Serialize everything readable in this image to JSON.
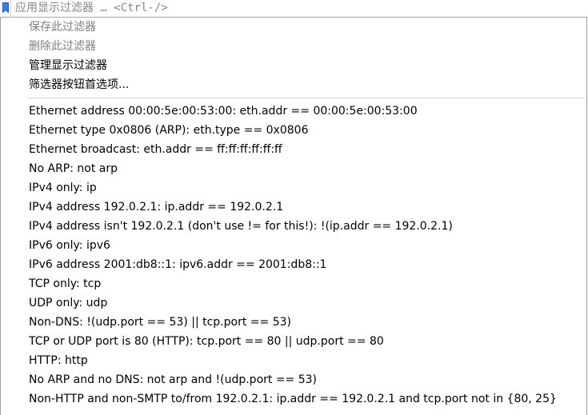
{
  "filter_bar": {
    "placeholder_label": "应用显示过滤器",
    "placeholder_shortcut": " … <Ctrl-/>",
    "bookmark_icon": "bookmark-icon"
  },
  "menu": {
    "actions": [
      {
        "label": "保存此过滤器",
        "enabled": false
      },
      {
        "label": "删除此过滤器",
        "enabled": false
      },
      {
        "label": "管理显示过滤器",
        "enabled": true
      },
      {
        "label": "筛选器按钮首选项...",
        "enabled": true
      }
    ],
    "saved_filters": [
      "Ethernet address 00:00:5e:00:53:00: eth.addr == 00:00:5e:00:53:00",
      "Ethernet type 0x0806 (ARP): eth.type == 0x0806",
      "Ethernet broadcast: eth.addr == ff:ff:ff:ff:ff:ff",
      "No ARP: not arp",
      "IPv4 only: ip",
      "IPv4 address 192.0.2.1: ip.addr == 192.0.2.1",
      "IPv4 address isn't 192.0.2.1 (don't use != for this!): !(ip.addr == 192.0.2.1)",
      "IPv6 only: ipv6",
      "IPv6 address 2001:db8::1: ipv6.addr == 2001:db8::1",
      "TCP only: tcp",
      "UDP only: udp",
      "Non-DNS: !(udp.port == 53) || tcp.port == 53)",
      "TCP or UDP port is 80 (HTTP): tcp.port == 80 || udp.port == 80",
      "HTTP: http",
      "No ARP and no DNS: not arp and !(udp.port == 53)",
      "Non-HTTP and non-SMTP to/from 192.0.2.1: ip.addr == 192.0.2.1 and tcp.port not in {80, 25}"
    ]
  },
  "colors": {
    "disabled_text": "#808080",
    "text": "#000000",
    "separator": "#d8d8d8",
    "bookmark_blue": "#3d7bd9"
  }
}
